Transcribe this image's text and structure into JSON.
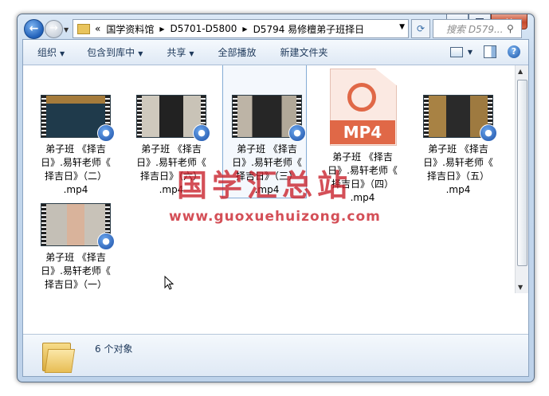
{
  "window": {
    "nav": {
      "breadcrumbs": [
        "«",
        "国学资料馆",
        "D5701-D5800",
        "D5794 易修檀弟子班择日"
      ],
      "search_placeholder": "搜索 D579..."
    },
    "toolbar": {
      "organize": "组织",
      "include_in_library": "包含到库中",
      "share": "共享",
      "play_all": "全部播放",
      "new_folder": "新建文件夹"
    },
    "files": [
      {
        "name": "弟子班 《择吉日》.易轩老师《择吉日》（二）.mp4",
        "lines": [
          "弟子班 《择吉",
          "日》.易轩老师《",
          "择吉日》（二）",
          ".mp4"
        ],
        "type": "video",
        "selected": false
      },
      {
        "name": "弟子班 《择吉日》.易轩老师《择吉日》（六）.mp4",
        "lines": [
          "弟子班 《择吉",
          "日》.易轩老师《",
          "择吉日》（六）",
          ".mp4"
        ],
        "type": "video",
        "selected": false
      },
      {
        "name": "弟子班 《择吉日》.易轩老师《择吉日》（三）.mp4",
        "lines": [
          "弟子班 《择吉",
          "日》.易轩老师《",
          "择吉日》（三）",
          ".mp4"
        ],
        "type": "video",
        "selected": true
      },
      {
        "name": "弟子班 《择吉日》.易轩老师《择吉日》（四）.mp4",
        "lines": [
          "弟子班 《择吉",
          "日》.易轩老师《",
          "择吉日》（四）",
          ".mp4"
        ],
        "type": "mp4-doc",
        "selected": false
      },
      {
        "name": "弟子班 《择吉日》.易轩老师《择吉日》（五）.mp4",
        "lines": [
          "弟子班 《择吉",
          "日》.易轩老师《",
          "择吉日》（五）",
          ".mp4"
        ],
        "type": "video",
        "selected": false
      },
      {
        "name": "弟子班 《择吉日》.易轩老师《择吉日》（一）",
        "lines": [
          "弟子班 《择吉",
          "日》.易轩老师《",
          "择吉日》（一）"
        ],
        "type": "video",
        "selected": false
      }
    ],
    "mp4_label": "MP4",
    "status": {
      "count": "6 个对象"
    }
  },
  "watermark": {
    "cn": "国学汇总站",
    "en": "www.guoxuehuizong.com"
  },
  "colors": {
    "accent": "#1c56a8",
    "watermark": "#c81e28",
    "mp4": "#e06847"
  }
}
